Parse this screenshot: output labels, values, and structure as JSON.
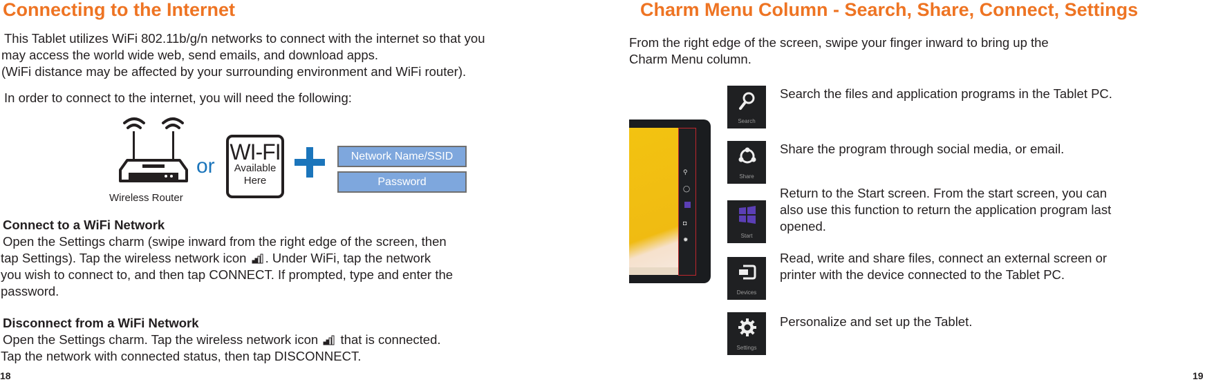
{
  "left_page": {
    "title": "Connecting to the Internet",
    "intro_lines": [
      "This Tablet utilizes WiFi 802.11b/g/n networks to connect with the internet so that you",
      "may access the world wide web, send emails, and download apps.",
      "(WiFi distance may be affected by your surrounding environment and WiFi router)."
    ],
    "need_line": "In order to connect to the internet, you will need the following:",
    "diagram": {
      "router_label": "Wireless Router",
      "or_label": "or",
      "wifi_sign_big": "WI-FI",
      "wifi_sign_line1": "Available",
      "wifi_sign_line2": "Here",
      "fields": [
        "Network Name/SSID",
        "Password"
      ],
      "accent_color": "#1b75bb",
      "field_color": "#7ea7dd"
    },
    "connect": {
      "heading": "Connect to a WiFi Network",
      "line1": "Open the Settings charm (swipe inward from the right edge of the screen, then",
      "line2a": "tap Settings). Tap the wireless network icon",
      "line2b": ". Under WiFi, tap the network",
      "line3": "you wish to connect to, and then tap CONNECT. If prompted, type and enter the",
      "line4": "password."
    },
    "disconnect": {
      "heading": "Disconnect from a WiFi Network",
      "line1a": "Open the Settings charm. Tap the wireless network icon",
      "line1b": "that is connected.",
      "line2": "Tap the network with connected status, then tap DISCONNECT."
    },
    "page_number": "18"
  },
  "right_page": {
    "title": "Charm Menu Column - Search, Share, Connect, Settings",
    "intro_lines": [
      "From the right edge of the screen, swipe your finger inward to bring up the",
      "Charm Menu column."
    ],
    "charms": [
      {
        "icon": "search-icon",
        "label": "Search",
        "desc": [
          "Search the files and application programs in the Tablet PC."
        ]
      },
      {
        "icon": "share-icon",
        "label": "Share",
        "desc": [
          "Share the program through social media, or email."
        ]
      },
      {
        "icon": "start-icon",
        "label": "Start",
        "desc": [
          "Return to the Start screen. From the start screen, you can",
          "also use this function to return the application program last",
          "opened."
        ]
      },
      {
        "icon": "devices-icon",
        "label": "Devices",
        "desc": [
          "Read, write and share files, connect an external screen or",
          "printer with the device connected to the Tablet PC."
        ]
      },
      {
        "icon": "settings-icon",
        "label": "Settings",
        "desc": [
          "Personalize and set up the Tablet."
        ]
      }
    ],
    "page_number": "19"
  },
  "colors": {
    "title": "#ee7423",
    "start_tile": "#5b3fb5",
    "charm_outline": "#c0272d"
  }
}
